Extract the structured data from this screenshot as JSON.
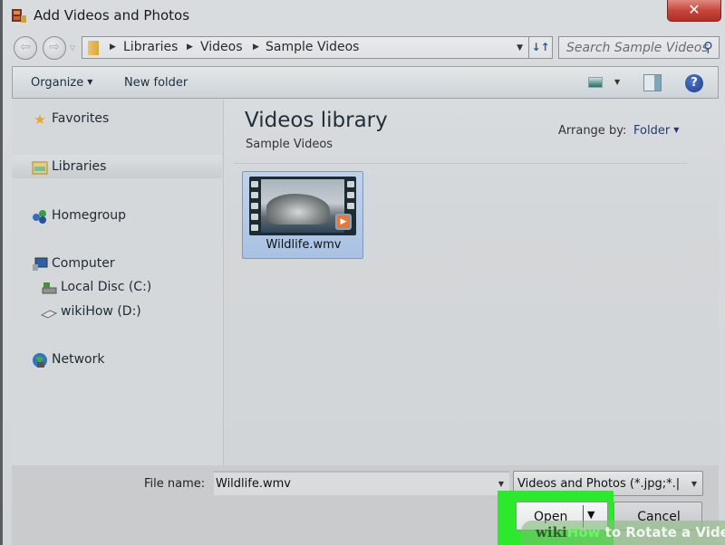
{
  "window": {
    "title": "Add Videos and Photos",
    "icon": "film-strip-icon",
    "close_label": "✕"
  },
  "navigation": {
    "back_icon": "back-arrow-icon",
    "forward_icon": "forward-arrow-icon",
    "breadcrumbs": [
      "Libraries",
      "Videos",
      "Sample Videos"
    ],
    "refresh_icon": "refresh-icon",
    "search_placeholder": "Search Sample Videos"
  },
  "toolbar": {
    "organize_label": "Organize",
    "new_folder_label": "New folder",
    "views_icon": "change-view-icon",
    "preview_icon": "preview-pane-icon",
    "help_icon": "help-icon"
  },
  "nav_pane": {
    "items": [
      {
        "label": "Favorites",
        "icon": "star-icon",
        "selected": false
      },
      {
        "label": "Libraries",
        "icon": "libraries-icon",
        "selected": true
      },
      {
        "label": "Homegroup",
        "icon": "homegroup-icon",
        "selected": false
      },
      {
        "label": "Computer",
        "icon": "computer-icon",
        "selected": false
      },
      {
        "label": "Local Disc (C:)",
        "icon": "drive-icon",
        "selected": false
      },
      {
        "label": "wikiHow (D:)",
        "icon": "removable-drive-icon",
        "selected": false
      },
      {
        "label": "Network",
        "icon": "network-icon",
        "selected": false
      }
    ]
  },
  "main": {
    "library_title": "Videos library",
    "library_subtitle": "Sample Videos",
    "arrange_label": "Arrange by:",
    "arrange_value": "Folder",
    "files": [
      {
        "name": "Wildlife.wmv",
        "type": "video",
        "selected": true
      }
    ]
  },
  "footer": {
    "file_name_label": "File name:",
    "file_name_value": "Wildlife.wmv",
    "filter_value": "Videos and Photos (*.jpg;*.|",
    "open_label": "Open",
    "cancel_label": "Cancel",
    "highlight_color": "#2ee82e"
  },
  "watermark": {
    "wiki": "wiki",
    "how": "How",
    "rest": " to Rotate a Video"
  }
}
